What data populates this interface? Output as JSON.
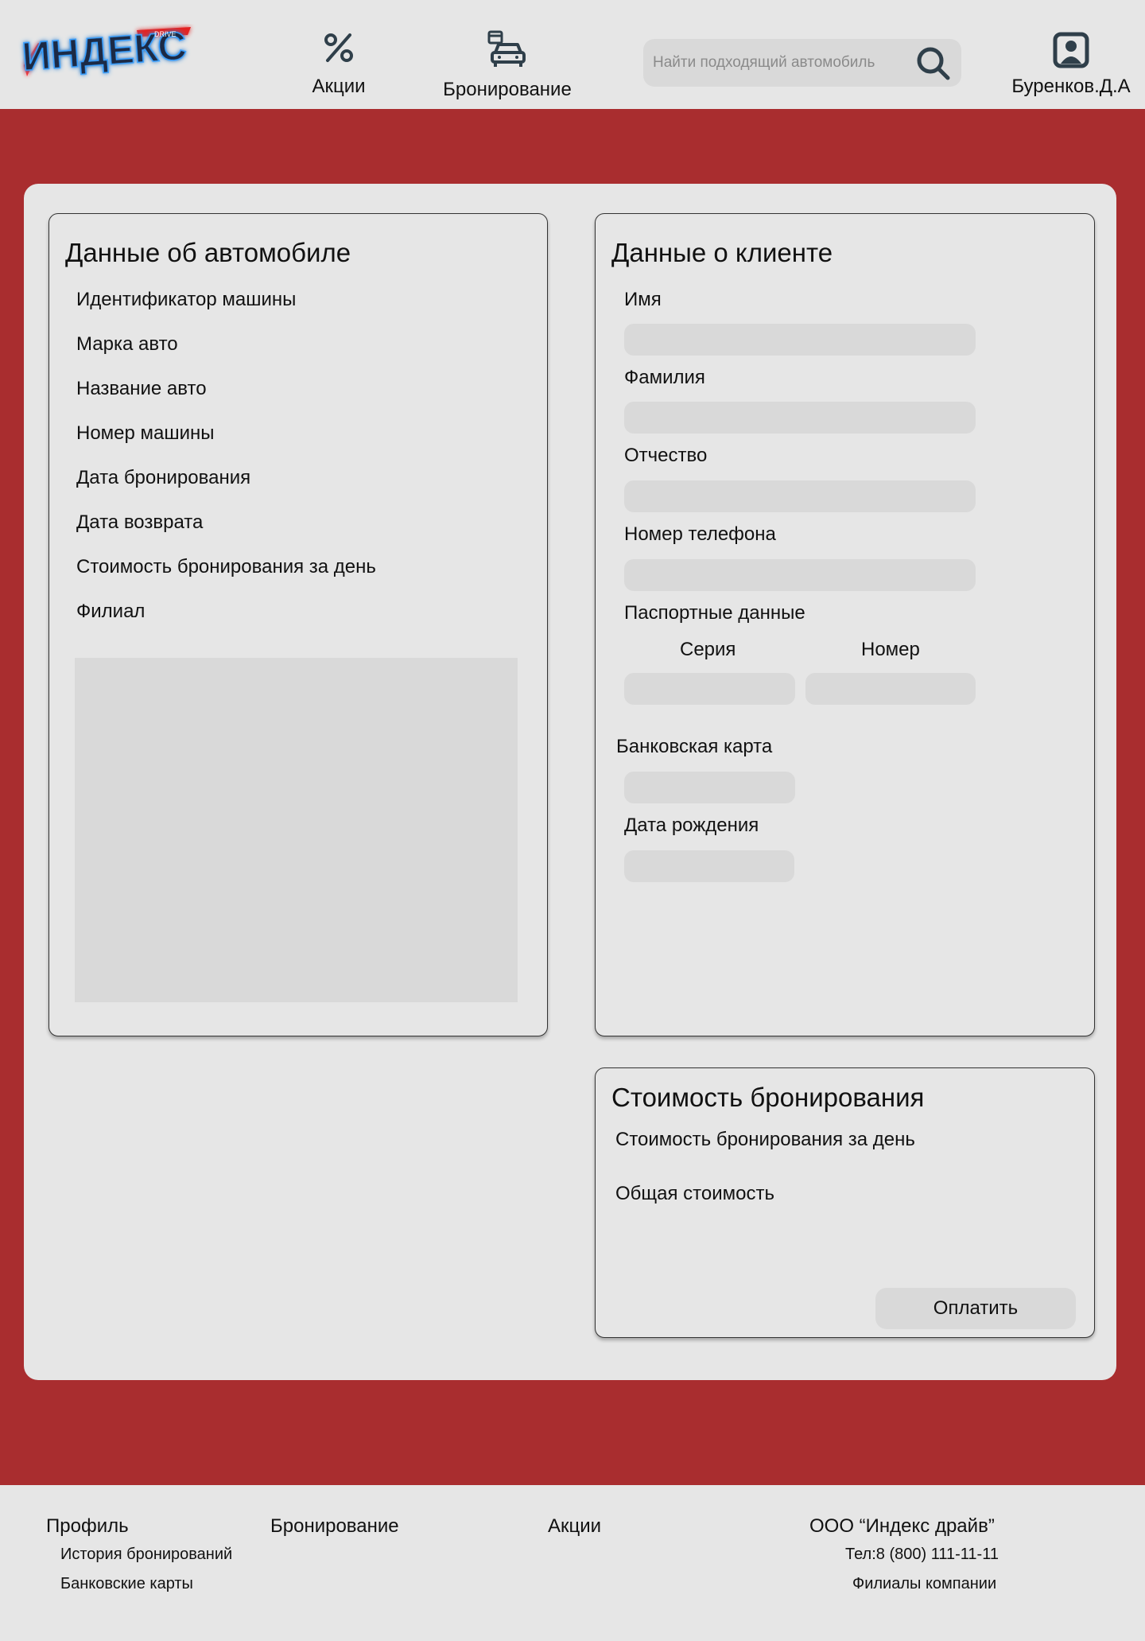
{
  "header": {
    "logo_text": "ИНДЕКС",
    "logo_sub": "DRIVE",
    "nav": {
      "promo_label": "Акции",
      "booking_label": "Бронирование"
    },
    "search": {
      "placeholder": "Найти подходящий автомобиль"
    },
    "profile_name": "Буренков.Д.А"
  },
  "car_panel": {
    "title": "Данные об автомобиле",
    "fields": [
      "Идентификатор машины",
      "Марка авто",
      "Название авто",
      "Номер машины",
      "Дата бронирования",
      "Дата возврата",
      "Стоимость бронирования за день",
      "Филиал"
    ]
  },
  "client_panel": {
    "title": "Данные о клиенте",
    "first_name_label": "Имя",
    "last_name_label": "Фамилия",
    "patronymic_label": "Отчество",
    "phone_label": "Номер телефона",
    "passport_label": "Паспортные данные",
    "passport_series_label": "Серия",
    "passport_number_label": "Номер",
    "bank_card_label": "Банковская карта",
    "birth_date_label": "Дата рождения"
  },
  "cost_panel": {
    "title": "Стоимость бронирования",
    "daily_cost_label": "Стоимость бронирования за день",
    "total_cost_label": "Общая стоимость",
    "pay_button": "Оплатить"
  },
  "footer": {
    "profile_heading": "Профиль",
    "profile_links": [
      "История бронирований",
      "Банковские карты"
    ],
    "booking_heading": "Бронирование",
    "promo_heading": "Акции",
    "company_name": "ООО “Индекс драйв”",
    "phone": "Тел:8 (800) 111-11-11",
    "branches_link": "Филиалы компании"
  },
  "colors": {
    "accent_red": "#a92d2f",
    "background": "#e6e6e6",
    "input_fill": "#d9d9d9",
    "icon_dark": "#2f3f4a"
  },
  "icons": {
    "promo": "percent-icon",
    "booking": "car-calendar-icon",
    "search": "search-icon",
    "profile": "user-portrait-icon"
  }
}
